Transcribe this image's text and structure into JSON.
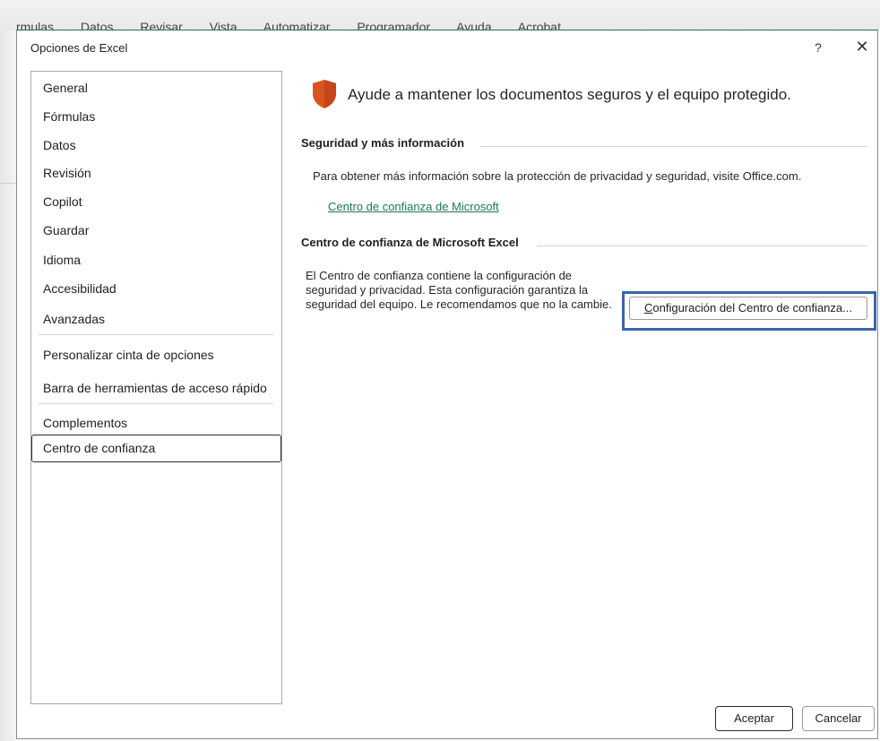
{
  "background_menu": [
    "rmulas",
    "Datos",
    "Revisar",
    "Vista",
    "Automatizar",
    "Programador",
    "Ayuda",
    "Acrobat"
  ],
  "dialog": {
    "title": "Opciones de Excel",
    "help_label": "?",
    "close_label": "✕"
  },
  "nav": {
    "items": [
      {
        "label": "General"
      },
      {
        "label": "Fórmulas"
      },
      {
        "label": "Datos"
      },
      {
        "label": "Revisión"
      },
      {
        "label": "Copilot"
      },
      {
        "label": "Guardar"
      },
      {
        "label": "Idioma"
      },
      {
        "label": "Accesibilidad"
      },
      {
        "label": "Avanzadas"
      },
      {
        "label": "Personalizar cinta de opciones"
      },
      {
        "label": "Barra de herramientas de acceso rápido"
      },
      {
        "label": "Complementos"
      },
      {
        "label": "Centro de confianza"
      }
    ],
    "selected": "Centro de confianza"
  },
  "content": {
    "headline": "Ayude a mantener los documentos seguros y el equipo protegido.",
    "section1_title": "Seguridad y más información",
    "section1_text": "Para obtener más información sobre la protección de privacidad y seguridad, visite Office.com.",
    "section1_link": "Centro de confianza de Microsoft",
    "section2_title": "Centro de confianza de Microsoft Excel",
    "section2_text": "El Centro de confianza contiene la configuración de seguridad y privacidad. Esta configuración garantiza la seguridad del equipo. Le recomendamos que no la cambie.",
    "trust_center_button": {
      "mnemonic": "C",
      "rest": "onfiguración del Centro de confianza..."
    }
  },
  "footer": {
    "ok_label": "Aceptar",
    "cancel_label": "Cancelar"
  },
  "colors": {
    "link": "#1e7a4a",
    "highlight": "#3a64a8",
    "shield": "#d9541e"
  },
  "icons": {
    "shield": "shield-icon",
    "help": "help-icon",
    "close": "close-icon"
  }
}
